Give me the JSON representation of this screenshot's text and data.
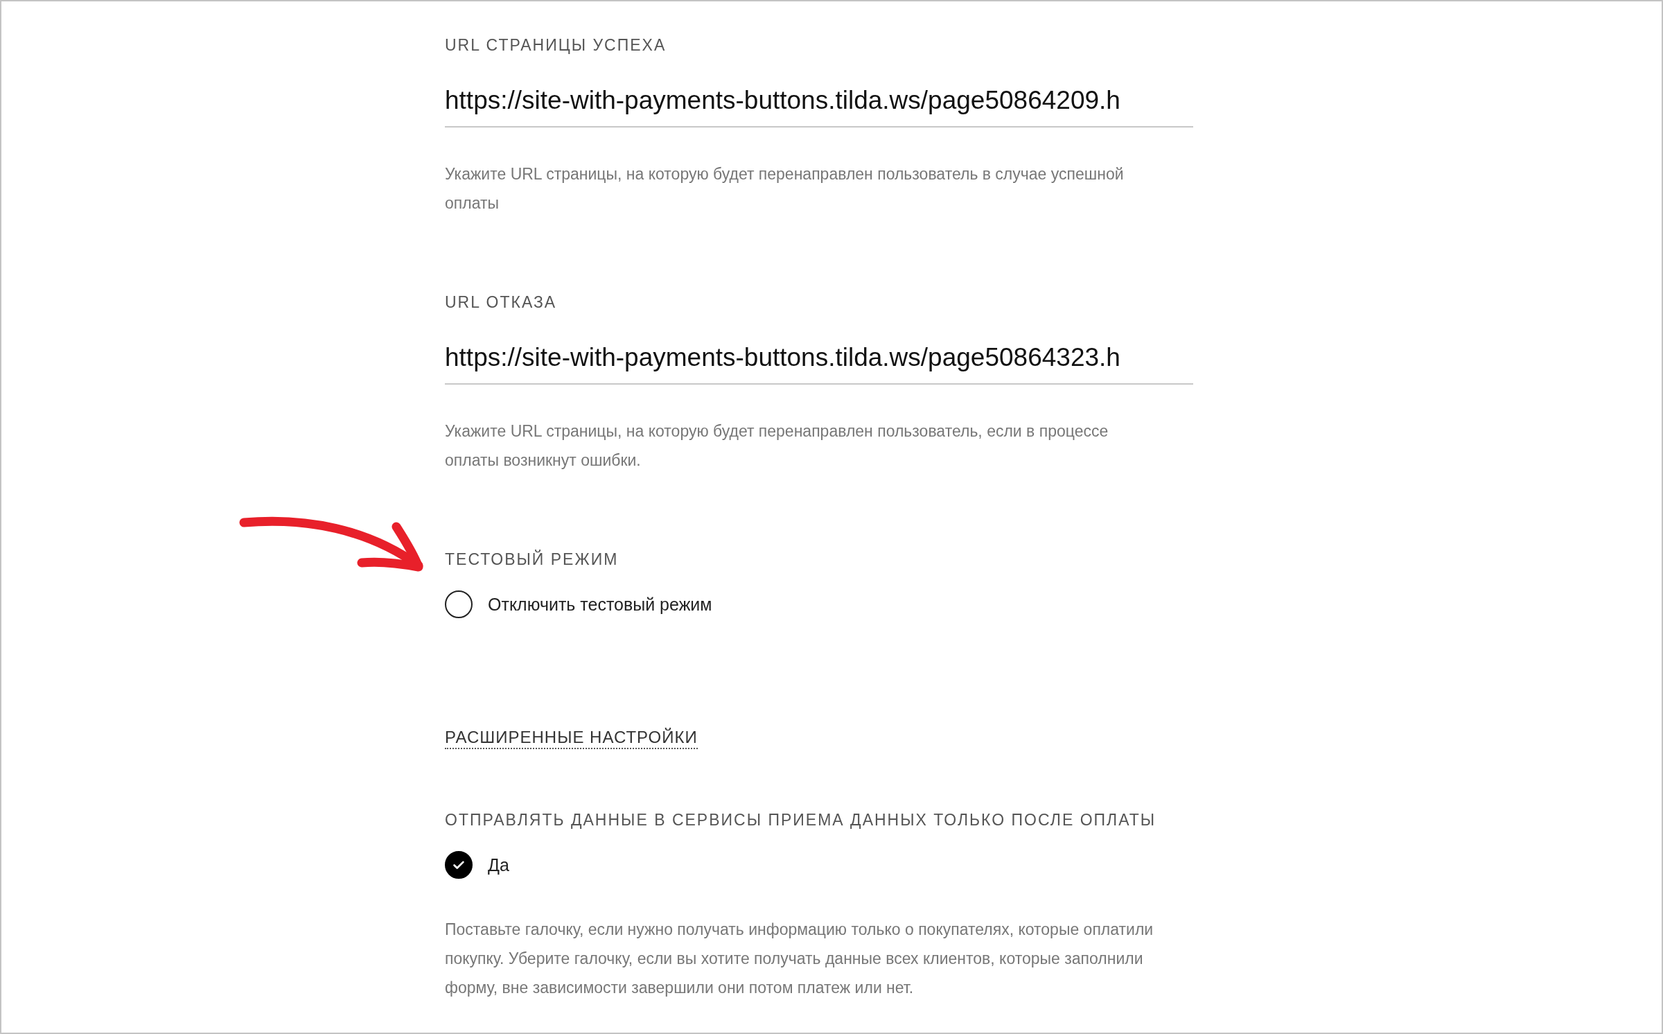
{
  "fields": [
    {
      "label": "URL СТРАНИЦЫ УСПЕХА",
      "value": "https://site-with-payments-buttons.tilda.ws/page50864209.h",
      "hint": "Укажите URL страницы, на которую будет перенаправлен пользователь в случае успешной оплаты"
    },
    {
      "label": "URL ОТКАЗА",
      "value": "https://site-with-payments-buttons.tilda.ws/page50864323.h",
      "hint": "Укажите URL страницы, на которую будет перенаправлен пользователь, если в процессе оплаты возникнут ошибки."
    }
  ],
  "test_mode": {
    "label": "ТЕСТОВЫЙ РЕЖИМ",
    "option": {
      "label": "Отключить тестовый режим",
      "checked": false
    }
  },
  "advanced_link": "РАСШИРЕННЫЕ НАСТРОЙКИ",
  "send_after_payment": {
    "label": "ОТПРАВЛЯТЬ ДАННЫЕ В СЕРВИСЫ ПРИЕМА ДАННЫХ ТОЛЬКО ПОСЛЕ ОПЛАТЫ",
    "option": {
      "label": "Да",
      "checked": true
    },
    "hint": "Поставьте галочку, если нужно получать информацию только о покупателях, которые оплатили покупку. Уберите галочку, если вы хотите получать данные всех клиентов, которые заполнили форму, вне зависимости завершили они потом платеж или нет."
  }
}
